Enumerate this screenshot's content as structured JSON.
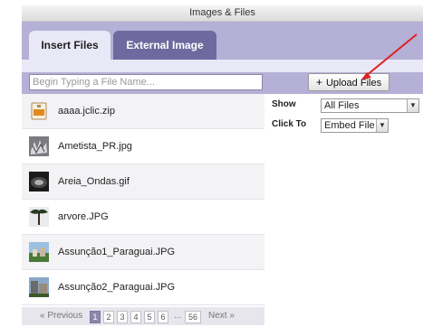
{
  "window": {
    "title": "Images & Files"
  },
  "tabs": [
    {
      "label": "Insert Files"
    },
    {
      "label": "External Image"
    }
  ],
  "search": {
    "placeholder": "Begin Typing a File Name..."
  },
  "upload": {
    "plus": "+",
    "label": "Upload Files"
  },
  "files": [
    {
      "name": "aaaa.jclic.zip",
      "icon": "zip-file-icon"
    },
    {
      "name": "Ametista_PR.jpg",
      "icon": "image-thumbnail"
    },
    {
      "name": "Areia_Ondas.gif",
      "icon": "image-thumbnail"
    },
    {
      "name": "arvore.JPG",
      "icon": "image-thumbnail"
    },
    {
      "name": "Assunção1_Paraguai.JPG",
      "icon": "image-thumbnail"
    },
    {
      "name": "Assunção2_Paraguai.JPG",
      "icon": "image-thumbnail"
    }
  ],
  "pager": {
    "previous": "« Previous",
    "pages": [
      "1",
      "2",
      "3",
      "4",
      "5",
      "6"
    ],
    "current": "1",
    "ellipsis": "...",
    "last": "56",
    "next": "Next »"
  },
  "options": {
    "show_label": "Show",
    "show_value": "All Files",
    "click_label": "Click To",
    "click_value": "Embed File",
    "dropdown_arrow": "▼"
  },
  "colors": {
    "accent": "#b4b0d6",
    "tab_active": "#e9e8f6",
    "tab_inactive": "#6e6a9f",
    "annotation_arrow": "#e02020"
  }
}
